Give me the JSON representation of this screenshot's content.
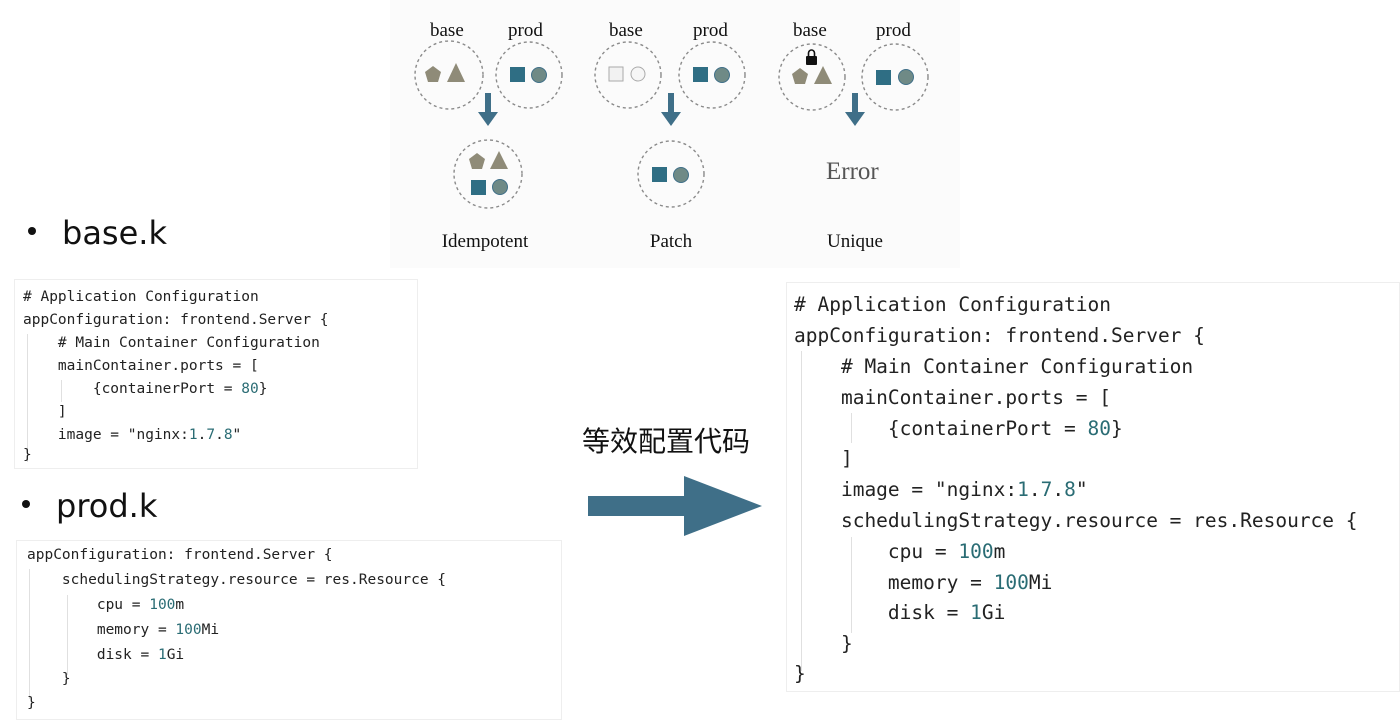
{
  "diagram": {
    "base_label": "base",
    "prod_label": "prod",
    "captions": [
      "Idempotent",
      "Patch",
      "Unique"
    ],
    "error_text": "Error",
    "colors": {
      "gray": "#8f8b78",
      "teal": "#2f6e84",
      "arrow": "#3f6f88"
    }
  },
  "bullets": {
    "base": "base.k",
    "prod": "prod.k"
  },
  "base_code": [
    "# Application Configuration",
    "appConfiguration: frontend.Server {",
    "    # Main Container Configuration",
    "    mainContainer.ports = [",
    "        {containerPort = 80}",
    "    ]",
    "    image = \"nginx:1.7.8\"",
    "}"
  ],
  "prod_code": [
    "appConfiguration: frontend.Server {",
    "    schedulingStrategy.resource = res.Resource {",
    "        cpu = 100m",
    "        memory = 100Mi",
    "        disk = 1Gi",
    "    }",
    "}"
  ],
  "equivalent_label": "等效配置代码",
  "merged_code": [
    "# Application Configuration",
    "appConfiguration: frontend.Server {",
    "    # Main Container Configuration",
    "    mainContainer.ports = [",
    "        {containerPort = 80}",
    "    ]",
    "    image = \"nginx:1.7.8\"",
    "    schedulingStrategy.resource = res.Resource {",
    "        cpu = 100m",
    "        memory = 100Mi",
    "        disk = 1Gi",
    "    }",
    "}"
  ]
}
